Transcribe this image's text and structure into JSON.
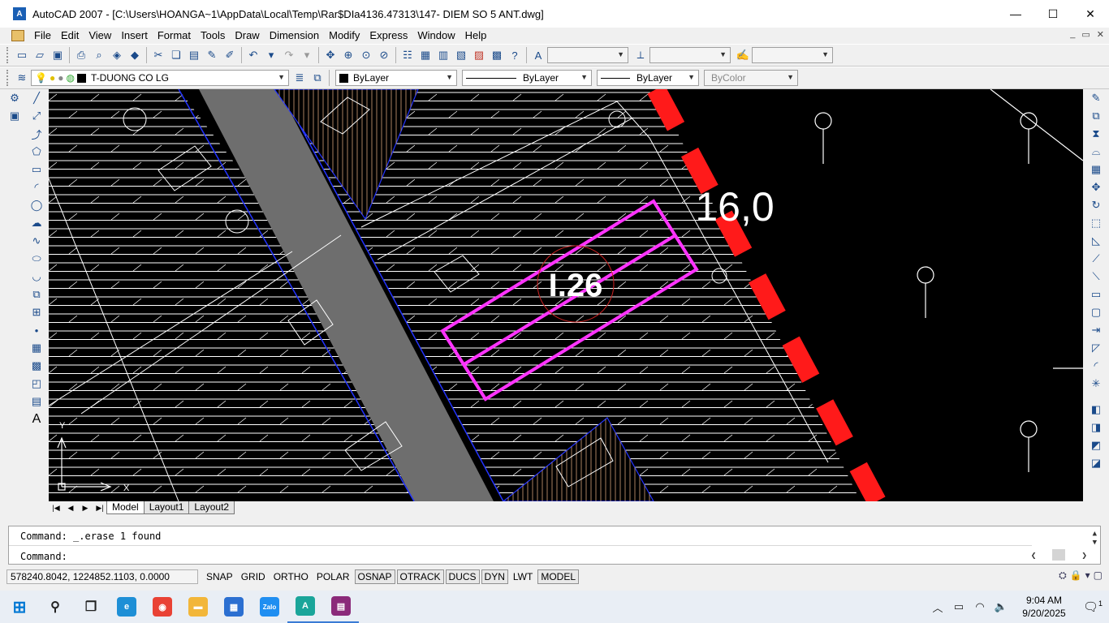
{
  "window": {
    "app_icon": "autocad-icon",
    "title": "AutoCAD 2007 - [C:\\Users\\HOANGA~1\\AppData\\Local\\Temp\\Rar$DIa4136.47313\\147- DIEM SO 5 ANT.dwg]",
    "minimize": "—",
    "maximize": "☐",
    "close": "✕"
  },
  "menu": {
    "items": [
      "File",
      "Edit",
      "View",
      "Insert",
      "Format",
      "Tools",
      "Draw",
      "Dimension",
      "Modify",
      "Express",
      "Window",
      "Help"
    ],
    "mdi_min": "_",
    "mdi_restore": "▭",
    "mdi_close": "✕"
  },
  "layer_toolbar": {
    "layer_name": "T-DUONG CO LG",
    "color": "ByLayer",
    "linetype": "ByLayer",
    "lineweight": "ByLayer",
    "plotstyle": "ByColor"
  },
  "drawing": {
    "text_dimension": "16,0",
    "text_label": "I.26",
    "colors": {
      "background": "#000000",
      "hatch": "#ffffff",
      "road": "#6e6e6e",
      "boundary": "#ff1a1a",
      "parcel": "#ff33ff",
      "edge": "#2233ff",
      "ortho_hatch": "#d2a07a"
    }
  },
  "tabs": {
    "nav": [
      "|◀",
      "◀",
      "▶",
      "▶|"
    ],
    "items": [
      "Model",
      "Layout1",
      "Layout2"
    ],
    "active": "Model"
  },
  "command": {
    "line1": "Command:  _.erase 1 found",
    "line2": "Command:"
  },
  "status": {
    "coords": "578240.8042, 1224852.1103, 0.0000",
    "buttons": [
      {
        "label": "SNAP",
        "on": false
      },
      {
        "label": "GRID",
        "on": false
      },
      {
        "label": "ORTHO",
        "on": false
      },
      {
        "label": "POLAR",
        "on": false
      },
      {
        "label": "OSNAP",
        "on": true
      },
      {
        "label": "OTRACK",
        "on": true
      },
      {
        "label": "DUCS",
        "on": true
      },
      {
        "label": "DYN",
        "on": true
      },
      {
        "label": "LWT",
        "on": false
      },
      {
        "label": "MODEL",
        "on": true
      }
    ]
  },
  "taskbar": {
    "apps": [
      {
        "name": "start-icon",
        "color": "#0078d4",
        "glyph": "⊞"
      },
      {
        "name": "search-icon",
        "color": "transparent",
        "glyph": "⚲"
      },
      {
        "name": "task-view-icon",
        "color": "transparent",
        "glyph": "❐"
      },
      {
        "name": "edge-icon",
        "color": "#1e8fd6",
        "glyph": "e"
      },
      {
        "name": "chrome-icon",
        "color": "#e94235",
        "glyph": "◉"
      },
      {
        "name": "file-explorer-icon",
        "color": "#f2b63a",
        "glyph": "▬"
      },
      {
        "name": "store-icon",
        "color": "#2b6fd1",
        "glyph": "▦"
      },
      {
        "name": "zalo-icon",
        "color": "#1f8ef1",
        "glyph": "Zalo"
      },
      {
        "name": "autocad-task-icon",
        "color": "#1aa59a",
        "glyph": "A"
      },
      {
        "name": "winrar-icon",
        "color": "#8b2a7a",
        "glyph": "▤"
      }
    ],
    "time": "9:04 AM",
    "date": "9/20/2025",
    "notif_count": "1"
  }
}
